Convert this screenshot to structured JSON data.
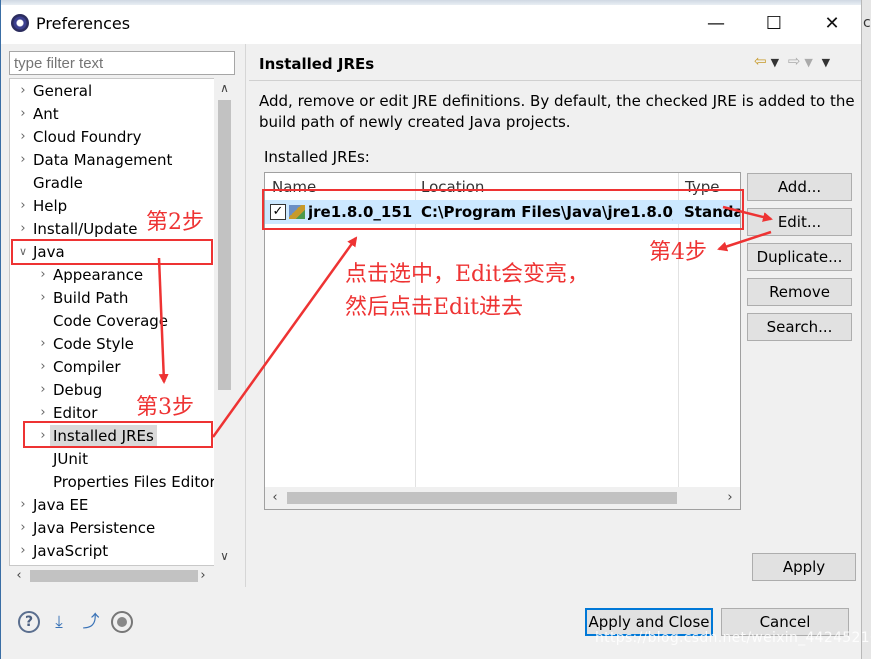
{
  "window": {
    "title": "Preferences",
    "icon": "eclipse-icon",
    "minimize": "—",
    "maximize": "☐",
    "close": "✕",
    "edge_fragment": "c"
  },
  "sidebar": {
    "filter_placeholder": "type filter text",
    "items": [
      {
        "label": "General",
        "expandable": true
      },
      {
        "label": "Ant",
        "expandable": true
      },
      {
        "label": "Cloud Foundry",
        "expandable": true
      },
      {
        "label": "Data Management",
        "expandable": true
      },
      {
        "label": "Gradle",
        "expandable": false
      },
      {
        "label": "Help",
        "expandable": true
      },
      {
        "label": "Install/Update",
        "expandable": true
      },
      {
        "label": "Java",
        "expandable": true,
        "expanded": true
      },
      {
        "label": "Appearance",
        "expandable": true
      },
      {
        "label": "Build Path",
        "expandable": true
      },
      {
        "label": "Code Coverage",
        "expandable": false
      },
      {
        "label": "Code Style",
        "expandable": true
      },
      {
        "label": "Compiler",
        "expandable": true
      },
      {
        "label": "Debug",
        "expandable": true
      },
      {
        "label": "Editor",
        "expandable": true
      },
      {
        "label": "Installed JREs",
        "expandable": true,
        "selected": true
      },
      {
        "label": "JUnit",
        "expandable": false
      },
      {
        "label": "Properties Files Editor",
        "expandable": false
      },
      {
        "label": "Java EE",
        "expandable": true
      },
      {
        "label": "Java Persistence",
        "expandable": true
      },
      {
        "label": "JavaScript",
        "expandable": true
      }
    ]
  },
  "page": {
    "title": "Installed JREs",
    "description": "Add, remove or edit JRE definitions. By default, the checked JRE is added to the build path of newly created Java projects.",
    "table_label": "Installed JREs:",
    "columns": [
      "Name",
      "Location",
      "Type"
    ],
    "rows": [
      {
        "checked": true,
        "name": "jre1.8.0_151...",
        "location": "C:\\Program Files\\Java\\jre1.8.0_...",
        "type": "Standa"
      }
    ],
    "side_buttons": [
      "Add...",
      "Edit...",
      "Duplicate...",
      "Remove",
      "Search..."
    ],
    "apply": "Apply"
  },
  "footer": {
    "apply_close": "Apply and Close",
    "cancel": "Cancel",
    "icons": [
      "help-icon",
      "import-icon",
      "export-icon",
      "record-icon"
    ],
    "watermark": "https://blog.csdn.net/weixin_44245216"
  },
  "annotations": {
    "step2": "第2步",
    "step3": "第3步",
    "step4": "第4步",
    "note_line1": "点击选中，Edit会变亮，",
    "note_line2": "然后点击Edit进去",
    "color": "#ee3333"
  },
  "colors": {
    "selection": "#cce8ff",
    "default_button_border": "#0078d7"
  }
}
